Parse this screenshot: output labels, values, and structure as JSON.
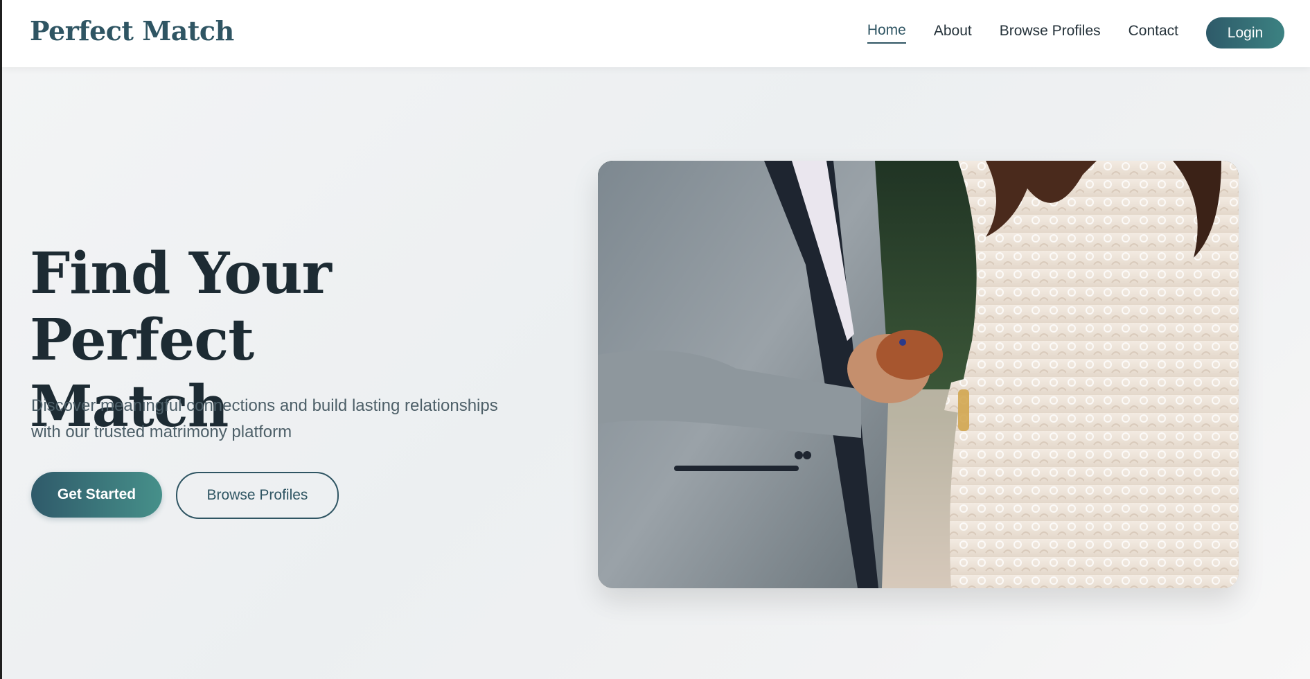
{
  "brand": {
    "logo": "Perfect Match"
  },
  "nav": {
    "links": [
      {
        "label": "Home",
        "active": true
      },
      {
        "label": "About",
        "active": false
      },
      {
        "label": "Browse Profiles",
        "active": false
      },
      {
        "label": "Contact",
        "active": false
      }
    ],
    "login_label": "Login"
  },
  "hero": {
    "title_line1": "Find Your Perfect",
    "title_line2": "Match",
    "subtitle_line1": "Discover meaningful connections and build lasting relationships",
    "subtitle_line2": "with our trusted matrimony platform",
    "primary_button": "Get Started",
    "secondary_button": "Browse Profiles"
  },
  "colors": {
    "brand": "#2f5563",
    "accent_gradient_start": "#2e5a69",
    "accent_gradient_end": "#46908a",
    "heading": "#1d2b33",
    "body_text": "#4d5f68"
  }
}
